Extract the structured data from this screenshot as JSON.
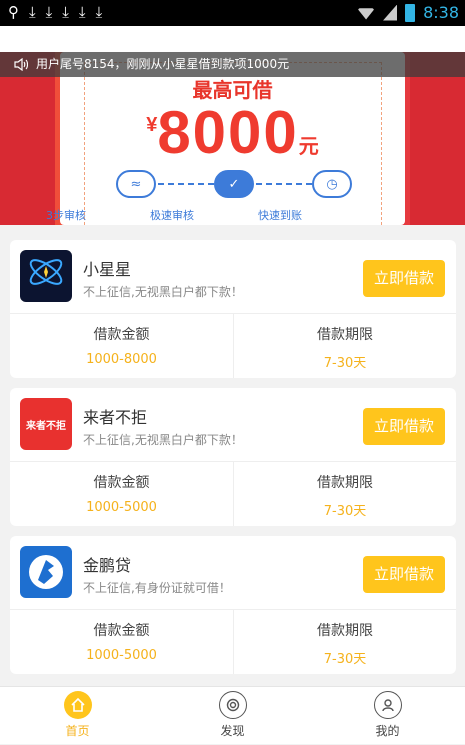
{
  "status_bar": {
    "time": "8:38"
  },
  "ticker": {
    "text": "用户尾号8154，刚刚从小星星借到款项1000元"
  },
  "banner": {
    "max_text": "最高可借",
    "currency": "¥",
    "amount": "8000",
    "unit": "元",
    "steps": [
      "3步审核",
      "极速审核",
      "快速到账"
    ]
  },
  "products": [
    {
      "name": "小星星",
      "desc": "不上征信,无视黑白户都下款！",
      "button": "立即借款",
      "amount_label": "借款金额",
      "amount": "1000-8000",
      "term_label": "借款期限",
      "term": "7-30天",
      "logo_text": "小星星"
    },
    {
      "name": "来者不拒",
      "desc": "不上征信,无视黑白户都下款！",
      "button": "立即借款",
      "amount_label": "借款金额",
      "amount": "1000-5000",
      "term_label": "借款期限",
      "term": "7-30天",
      "logo_text": "来者不拒"
    },
    {
      "name": "金鹏贷",
      "desc": "不上征信,有身份证就可借！",
      "button": "立即借款",
      "amount_label": "借款金额",
      "amount": "1000-5000",
      "term_label": "借款期限",
      "term": "7-30天",
      "logo_text": ""
    }
  ],
  "tabs": [
    {
      "label": "首页",
      "icon": "home-icon"
    },
    {
      "label": "发现",
      "icon": "discover-icon"
    },
    {
      "label": "我的",
      "icon": "profile-icon"
    }
  ],
  "colors": {
    "accent": "#ffc51c",
    "value": "#f5b21c",
    "banner_red": "#e63a3f"
  }
}
